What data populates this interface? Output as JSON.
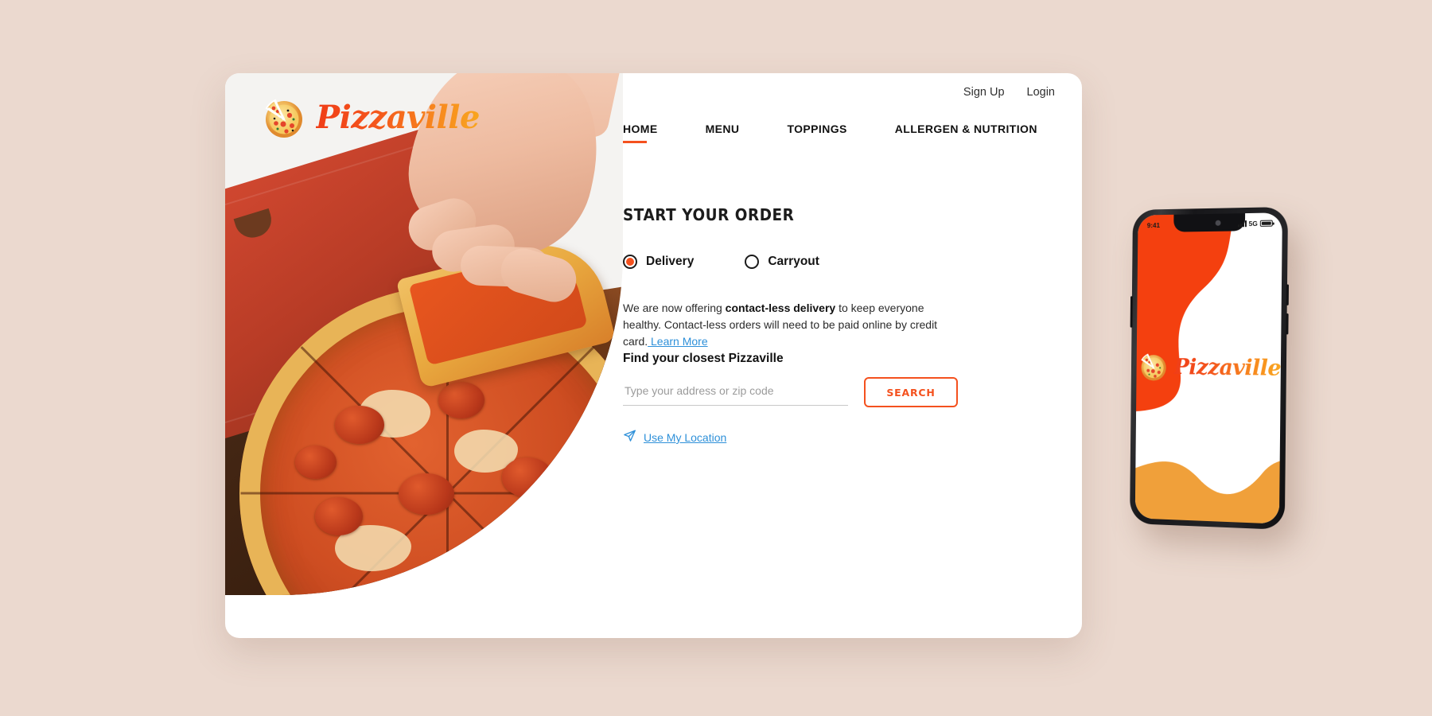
{
  "brand": {
    "name": "Pizzaville",
    "logo_icon": "pizza-slice-icon",
    "accent_orange": "#F4511E",
    "accent_amber": "#F0A03A",
    "link_blue": "#2E90D9",
    "page_background": "#EBD9CF"
  },
  "account_bar": {
    "sign_up": "Sign Up",
    "login": "Login"
  },
  "nav": {
    "items": [
      {
        "label": "HOME",
        "active": true
      },
      {
        "label": "MENU",
        "active": false
      },
      {
        "label": "TOPPINGS",
        "active": false
      },
      {
        "label": "ALLERGEN & NUTRITION",
        "active": false
      }
    ]
  },
  "order": {
    "title": "START YOUR ORDER",
    "modes": [
      {
        "label": "Delivery",
        "selected": true
      },
      {
        "label": "Carryout",
        "selected": false
      }
    ],
    "notice": {
      "line1_before": "We are now offering ",
      "line1_bold": "contact-less delivery",
      "line1_after": " to keep everyone healthy.",
      "line2": "Contact-less orders will need to be paid online by credit card.",
      "learn_more": " Learn More"
    },
    "find_title": "Find your closest Pizzaville",
    "address_placeholder": "Type your address or zip code",
    "address_value": "",
    "search_label": "SEARCH",
    "use_location_label": "Use My Location",
    "use_location_icon": "navigation-arrow-icon"
  },
  "phone": {
    "status": {
      "time": "9:41",
      "network": "5G",
      "signal_icon": "signal-bars-icon",
      "battery_icon": "battery-icon"
    },
    "splash_brand": "Pizzaville"
  }
}
